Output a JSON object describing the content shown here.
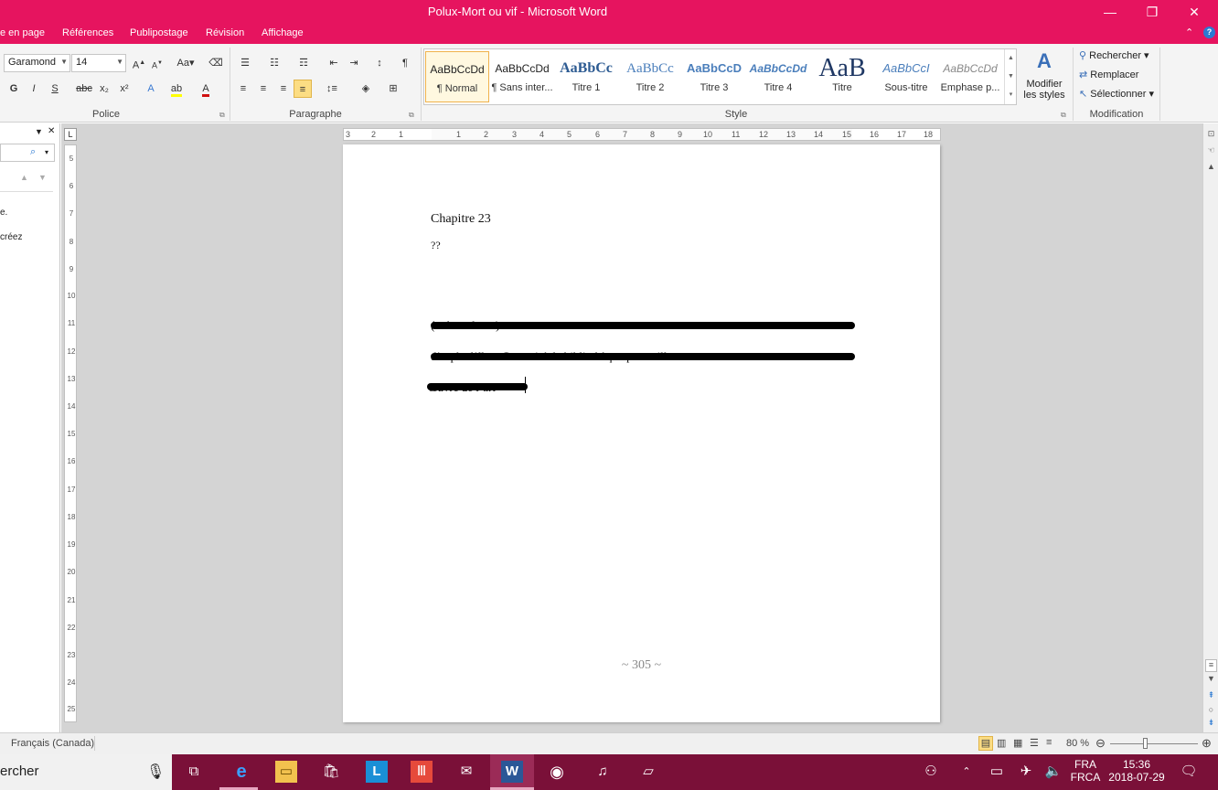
{
  "window": {
    "title": "Polux-Mort ou vif  -  Microsoft Word",
    "minimize": "—",
    "restore": "❐",
    "close": "✕"
  },
  "tabs": [
    "e en page",
    "Références",
    "Publipostage",
    "Révision",
    "Affichage"
  ],
  "ribbon": {
    "font": {
      "name": "Garamond",
      "size": "14",
      "group_label": "Police"
    },
    "paragraph": {
      "group_label": "Paragraphe"
    },
    "styles": {
      "group_label": "Style",
      "items": [
        {
          "preview": "AaBbCcDd",
          "label": "¶ Normal"
        },
        {
          "preview": "AaBbCcDd",
          "label": "¶ Sans inter..."
        },
        {
          "preview": "AaBbCc",
          "label": "Titre 1"
        },
        {
          "preview": "AaBbCc",
          "label": "Titre 2"
        },
        {
          "preview": "AaBbCcD",
          "label": "Titre 3"
        },
        {
          "preview": "AaBbCcDd",
          "label": "Titre 4"
        },
        {
          "preview": "AaB",
          "label": "Titre"
        },
        {
          "preview": "AaBbCcI",
          "label": "Sous-titre"
        },
        {
          "preview": "AaBbCcDd",
          "label": "Emphase p..."
        }
      ],
      "change_styles": "Modifier",
      "change_styles_2": "les styles"
    },
    "editing": {
      "group_label": "Modification",
      "find": "Rechercher",
      "replace": "Remplacer",
      "select": "Sélectionner"
    }
  },
  "navpane": {
    "text1": "e.",
    "text2": "créez"
  },
  "ruler": {
    "h_ticks": [
      "3",
      "2",
      "1",
      "1",
      "2",
      "3",
      "4",
      "5",
      "6",
      "7",
      "8",
      "9",
      "10",
      "11",
      "12",
      "13",
      "14",
      "15",
      "16",
      "17",
      "18"
    ],
    "v_ticks": [
      "5",
      "6",
      "7",
      "8",
      "9",
      "10",
      "11",
      "12",
      "13",
      "14",
      "15",
      "16",
      "17",
      "18",
      "19",
      "20",
      "21",
      "22",
      "23",
      "24",
      "25"
    ]
  },
  "document": {
    "chapter": "Chapitre 23",
    "subtitle": "??",
    "line1": "(redacted text)",
    "line2": "d’orphe l’île... Cette cité de bibliothèque pour ville",
    "line3": "œuvre de l’art",
    "page_number": "~ 305 ~"
  },
  "status": {
    "language": "Français (Canada)",
    "zoom": "80 %"
  },
  "taskbar": {
    "search": "ercher",
    "lang1": "FRA",
    "lang2": "FRCA",
    "time": "15:36",
    "date": "2018-07-29"
  },
  "colors": {
    "accent": "#e6145f",
    "taskbar": "#7a1038"
  }
}
